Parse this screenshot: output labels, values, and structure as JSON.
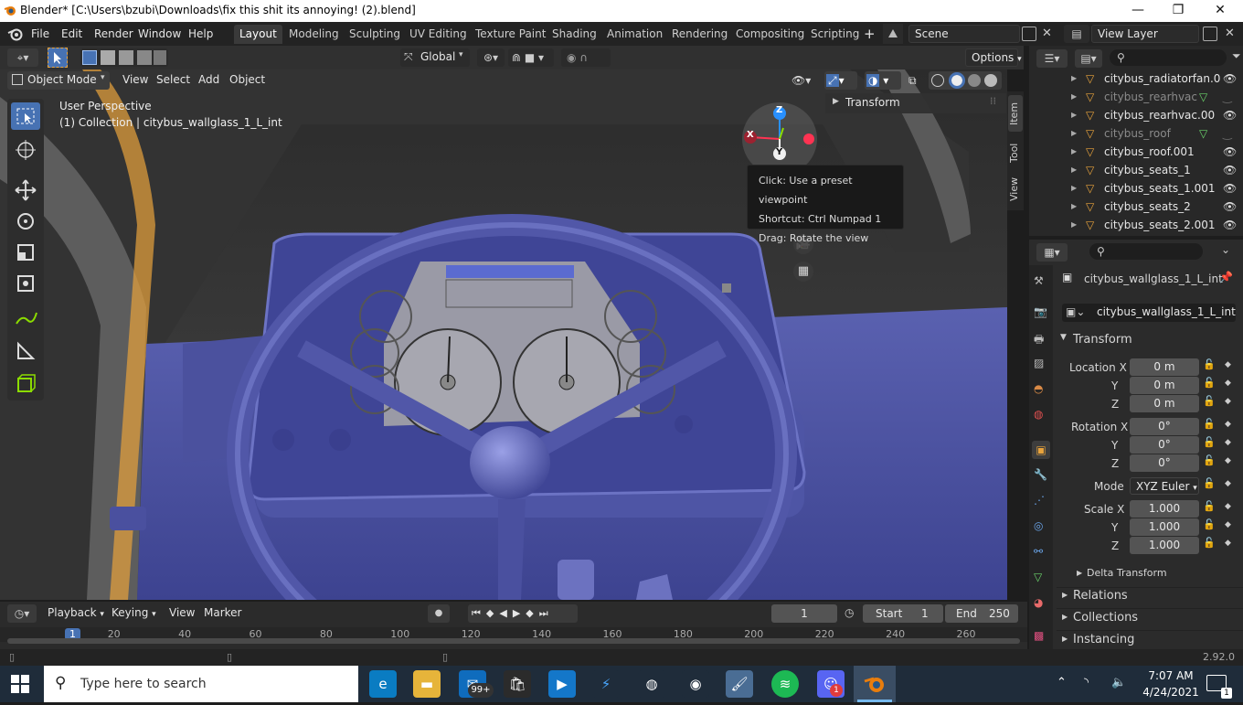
{
  "window": {
    "title": "Blender* [C:\\Users\\bzubi\\Downloads\\fix this shit its annoying! (2).blend]",
    "min": "—",
    "max": "❐",
    "close": "✕"
  },
  "menu": [
    "File",
    "Edit",
    "Render",
    "Window",
    "Help"
  ],
  "workspaces": [
    "Layout",
    "Modeling",
    "Sculpting",
    "UV Editing",
    "Texture Paint",
    "Shading",
    "Animation",
    "Rendering",
    "Compositing",
    "Scripting"
  ],
  "active_workspace": "Layout",
  "scene": {
    "name": "Scene"
  },
  "view_layer": {
    "name": "View Layer"
  },
  "vp_header": {
    "transform_orientation": "Global",
    "options": "Options"
  },
  "vp_menu": {
    "mode": "Object Mode",
    "view": "View",
    "select": "Select",
    "add": "Add",
    "object": "Object"
  },
  "viewport": {
    "perspective": "User Perspective",
    "collection": "(1) Collection | citybus_wallglass_1_L_int"
  },
  "gizmo": {
    "z": "Z",
    "x": "X",
    "y": "Y"
  },
  "tooltip": {
    "line1": "Click: Use a preset viewpoint",
    "line2": "Shortcut: Ctrl Numpad 1",
    "line3": "Drag: Rotate the view"
  },
  "npanel": {
    "transform": "Transform",
    "tabs": [
      "Item",
      "Tool",
      "View"
    ]
  },
  "outliner": {
    "items": [
      {
        "name": "citybus_radiatorfan.0",
        "dim": false
      },
      {
        "name": "citybus_rearhvac",
        "dim": true
      },
      {
        "name": "citybus_rearhvac.00",
        "dim": false
      },
      {
        "name": "citybus_roof",
        "dim": true
      },
      {
        "name": "citybus_roof.001",
        "dim": false
      },
      {
        "name": "citybus_seats_1",
        "dim": false
      },
      {
        "name": "citybus_seats_1.001",
        "dim": false
      },
      {
        "name": "citybus_seats_2",
        "dim": false
      },
      {
        "name": "citybus_seats_2.001",
        "dim": false
      }
    ]
  },
  "properties": {
    "object_name": "citybus_wallglass_1_L_int",
    "data_name": "citybus_wallglass_1_L_int",
    "transform": "Transform",
    "location_label": "Location X",
    "loc_x": "0 m",
    "loc_y": "0 m",
    "loc_z": "0 m",
    "rotation_label": "Rotation X",
    "rot_x": "0°",
    "rot_y": "0°",
    "rot_z": "0°",
    "mode_label": "Mode",
    "mode_value": "XYZ Euler",
    "scale_label": "Scale X",
    "scale_x": "1.000",
    "scale_y": "1.000",
    "scale_z": "1.000",
    "y": "Y",
    "z": "Z",
    "delta": "Delta Transform",
    "relations": "Relations",
    "collections": "Collections",
    "instancing": "Instancing"
  },
  "timeline": {
    "playback": "Playback",
    "keying": "Keying",
    "view": "View",
    "marker": "Marker",
    "current_frame": "1",
    "start_label": "Start",
    "start": "1",
    "end_label": "End",
    "end": "250",
    "ticks": [
      "1",
      "20",
      "40",
      "60",
      "80",
      "100",
      "120",
      "140",
      "160",
      "180",
      "200",
      "220",
      "240",
      "260"
    ]
  },
  "status": {
    "version": "2.92.0"
  },
  "taskbar": {
    "search_placeholder": "Type here to search",
    "time": "7:07 AM",
    "date": "4/24/2021",
    "mail_badge": "99+",
    "discord_badge": "1",
    "notif": "1"
  },
  "colors": {
    "accent": "#4772b3",
    "blender_orange": "#e87d0d",
    "mesh": "#4e55a0",
    "x_axis": "#ff3352",
    "y_axis": "#8bdc00",
    "z_axis": "#2890ff"
  }
}
